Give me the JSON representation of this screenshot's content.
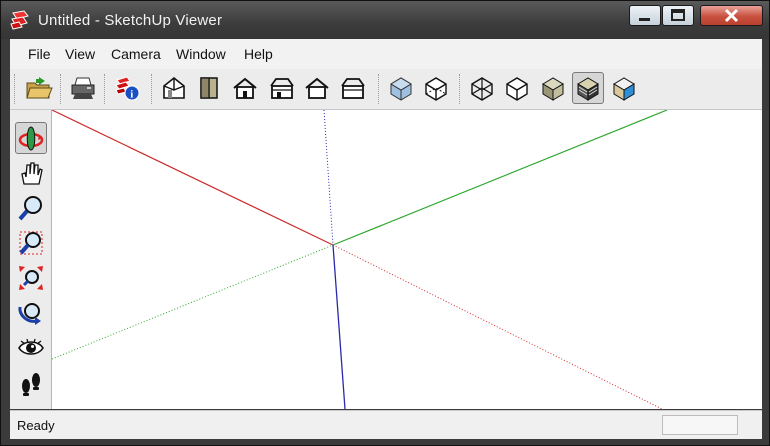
{
  "window": {
    "title": "Untitled - SketchUp Viewer"
  },
  "menu": {
    "items": [
      "File",
      "View",
      "Camera",
      "Window",
      "Help"
    ]
  },
  "toolbar": {
    "icons": [
      "open-file-icon",
      "print-icon",
      "model-info-icon",
      "iso-view-icon",
      "top-view-icon",
      "front-view-icon",
      "right-view-icon",
      "back-view-icon",
      "left-view-icon",
      "xray-icon",
      "back-edges-icon",
      "wireframe-icon",
      "hidden-line-icon",
      "shaded-icon",
      "shaded-with-textures-icon",
      "monochrome-icon"
    ],
    "active": "shaded-with-textures-icon"
  },
  "left_tools": {
    "icons": [
      "orbit-icon",
      "pan-icon",
      "zoom-icon",
      "zoom-window-icon",
      "zoom-extents-icon",
      "previous-view-icon",
      "look-around-icon",
      "walk-icon"
    ],
    "active": "orbit-icon"
  },
  "axes": {
    "red": "#cc2b2b",
    "green": "#2fa82f",
    "blue": "#2a2aa8"
  },
  "status": {
    "text": "Ready"
  }
}
